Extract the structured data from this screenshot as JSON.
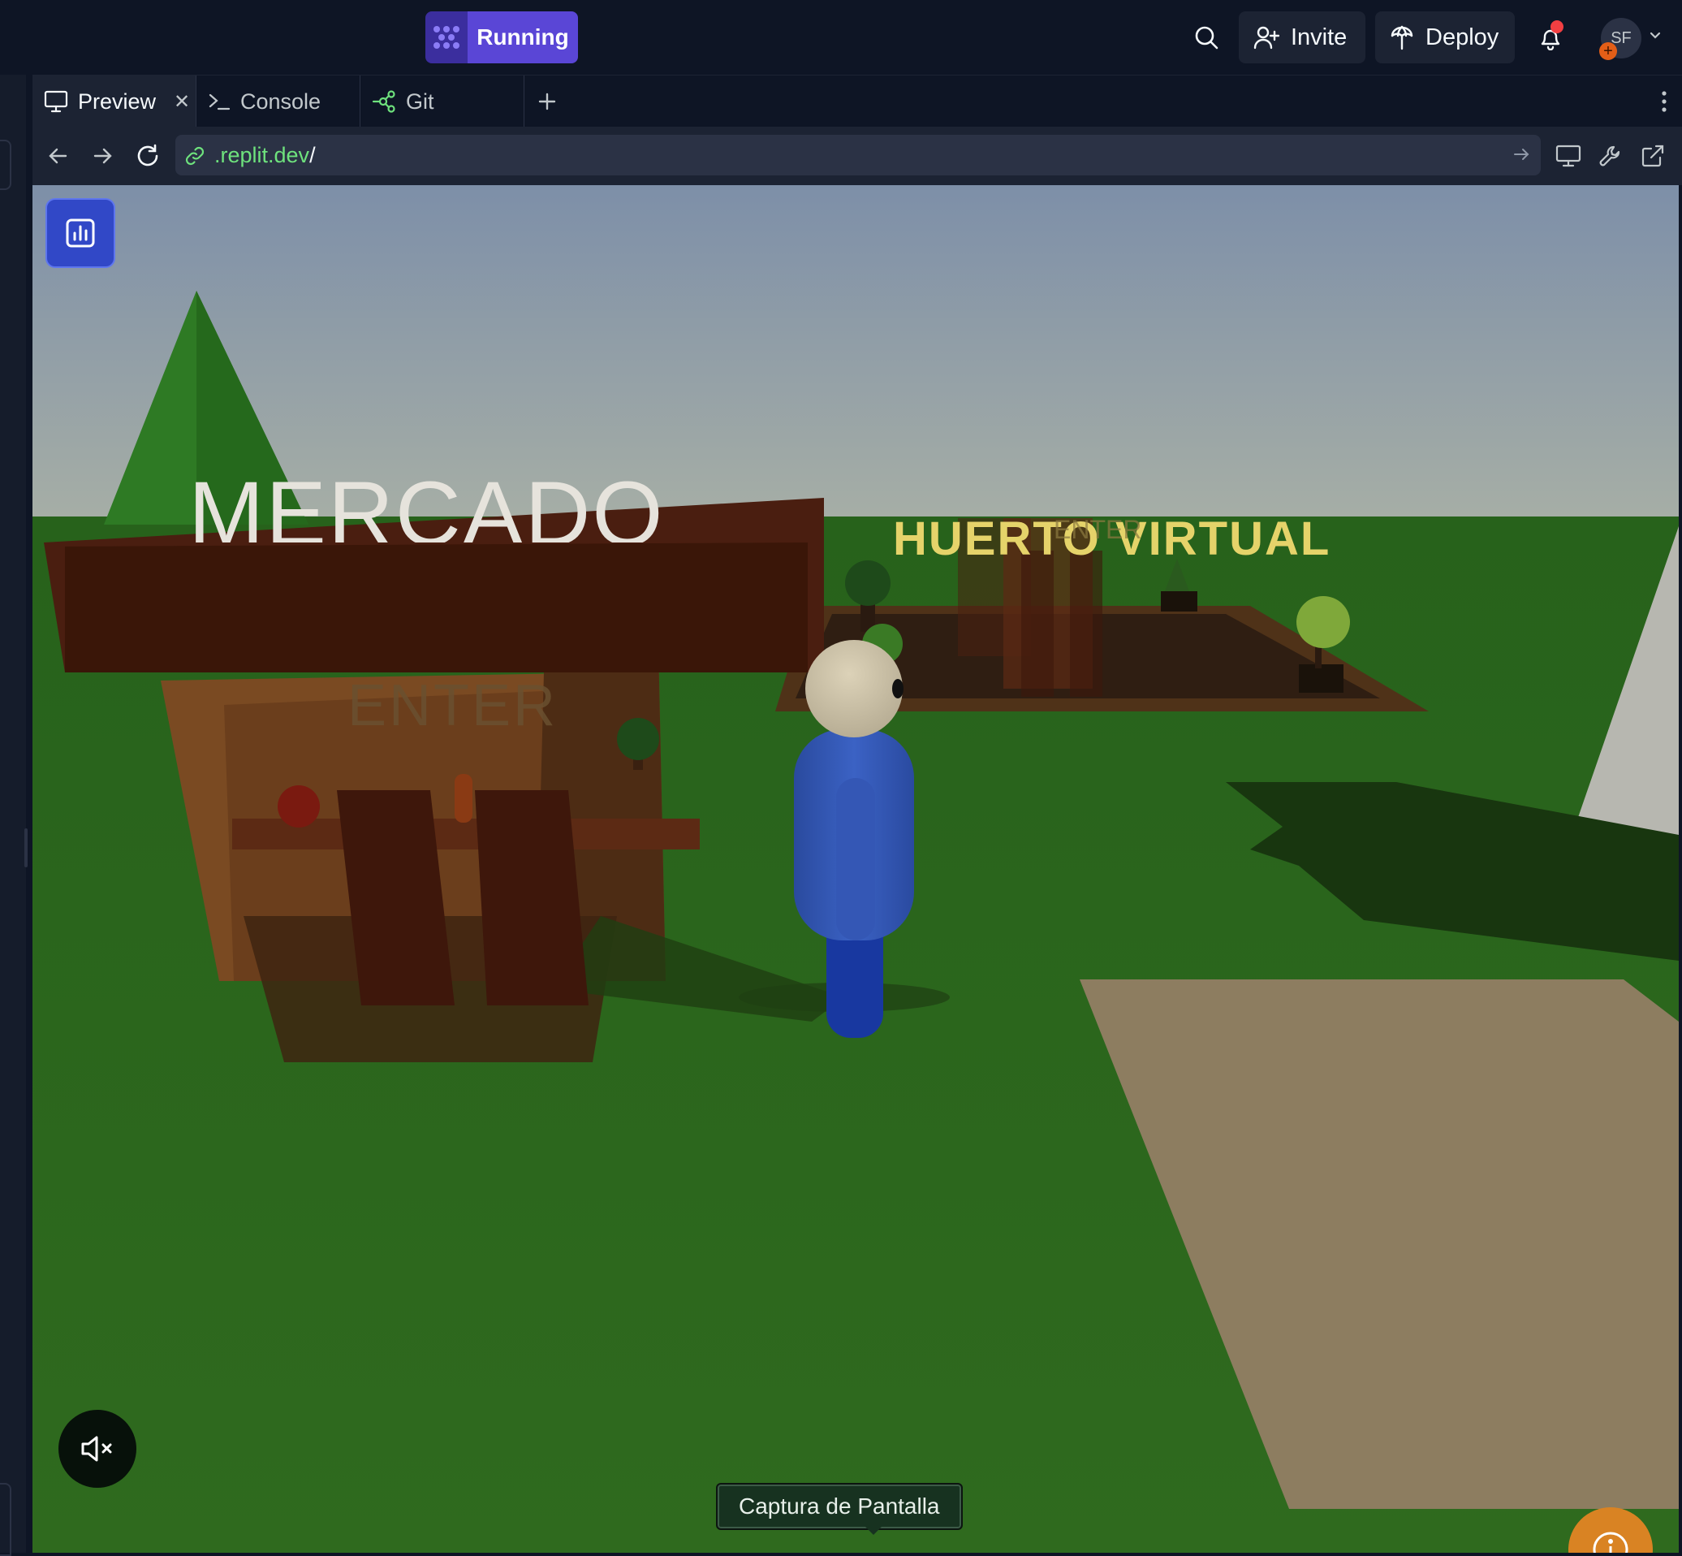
{
  "header": {
    "run_label": "Running",
    "invite_label": "Invite",
    "deploy_label": "Deploy",
    "avatar_initials": "SF"
  },
  "tabs": [
    {
      "label": "Preview",
      "active": true
    },
    {
      "label": "Console",
      "active": false
    },
    {
      "label": "Git",
      "active": false
    }
  ],
  "urlbar": {
    "host": ".replit.dev",
    "path": "/"
  },
  "scene": {
    "sign_market": "MERCADO",
    "sign_market_enter": "ENTER",
    "sign_garden": "HUERTO VIRTUAL",
    "sign_garden_enter": "ENTER"
  },
  "overlay": {
    "tooltip": "Captura de Pantalla"
  },
  "colors": {
    "run_accent": "#5a46d6",
    "url_host": "#6ee27d",
    "notification_dot": "#f23f42",
    "stats_button": "#3148c7",
    "help_button": "#d98323"
  },
  "icons": [
    "run-icon",
    "search-icon",
    "add-user-icon",
    "deploy-icon",
    "bell-icon",
    "chevron-down-icon",
    "monitor-icon",
    "terminal-icon",
    "git-icon",
    "plus-icon",
    "more-vertical-icon",
    "arrow-left-icon",
    "arrow-right-icon",
    "refresh-icon",
    "link-icon",
    "monitor-icon",
    "wrench-icon",
    "external-link-icon",
    "stats-chart-icon",
    "volume-mute-icon"
  ]
}
